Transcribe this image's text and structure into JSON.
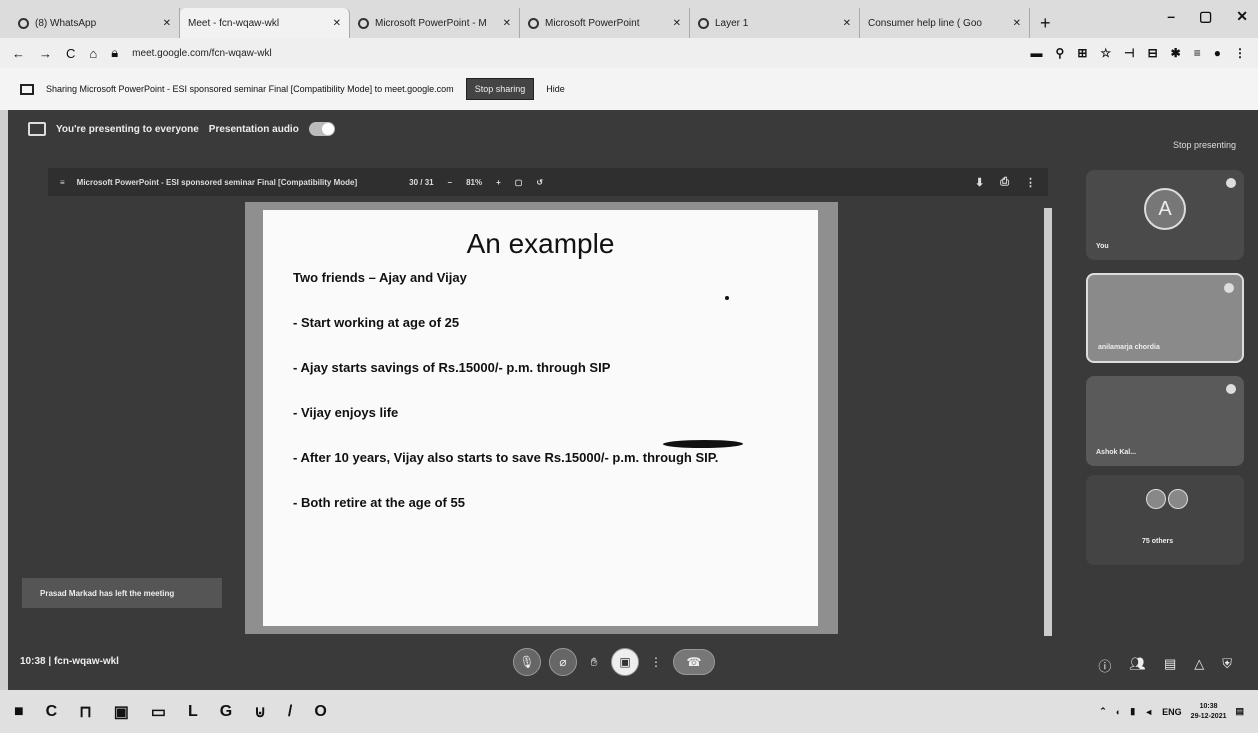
{
  "browser": {
    "tabs": [
      {
        "label": "(8) WhatsApp",
        "icon": "whatsapp-icon"
      },
      {
        "label": "Meet - fcn-wqaw-wkl",
        "icon": "meet-icon"
      },
      {
        "label": "Microsoft PowerPoint - M",
        "icon": "chrome-icon"
      },
      {
        "label": "Microsoft PowerPoint",
        "icon": "chrome-icon"
      },
      {
        "label": "Layer 1",
        "icon": "chrome-icon"
      },
      {
        "label": "Consumer help line ( Goo",
        "icon": "youtube-icon"
      }
    ],
    "new_tab": "+",
    "url": "meet.google.com/fcn-wqaw-wkl"
  },
  "share_bar": {
    "text": "Sharing Microsoft PowerPoint - ESI sponsored seminar Final [Compatibility Mode] to meet.google.com",
    "stop_button": "Stop sharing",
    "hide_button": "Hide"
  },
  "meet": {
    "presenting_text": "You're presenting to everyone",
    "audio_label": "Presentation audio",
    "stop_presenting": "Stop presenting",
    "ppt_title": "Microsoft PowerPoint - ESI sponsored seminar Final [Compatibility Mode]",
    "page_info": "30 / 31",
    "zoom": "81%",
    "toast": "Prasad Markad has left the meeting",
    "meeting_time": "10:38",
    "meeting_code": "fcn-wqaw-wkl"
  },
  "slide": {
    "title": "An example",
    "subtitle": "Two friends – Ajay and Vijay",
    "bullets": [
      "- Start working at age of 25",
      "- Ajay starts savings of Rs.15000/- p.m. through SIP",
      "- Vijay enjoys life",
      "- After 10 years, Vijay also starts to save Rs.15000/- p.m. through SIP.",
      "- Both retire at the age of 55"
    ]
  },
  "participants": {
    "you": {
      "initial": "A",
      "label": "You"
    },
    "second": {
      "label": "anilamarja chordia"
    },
    "third": {
      "label": "Ashok Kal..."
    },
    "others": {
      "label": "75 others"
    }
  },
  "taskbar": {
    "lang": "ENG",
    "time": "10:38",
    "date": "29-12-2021"
  }
}
